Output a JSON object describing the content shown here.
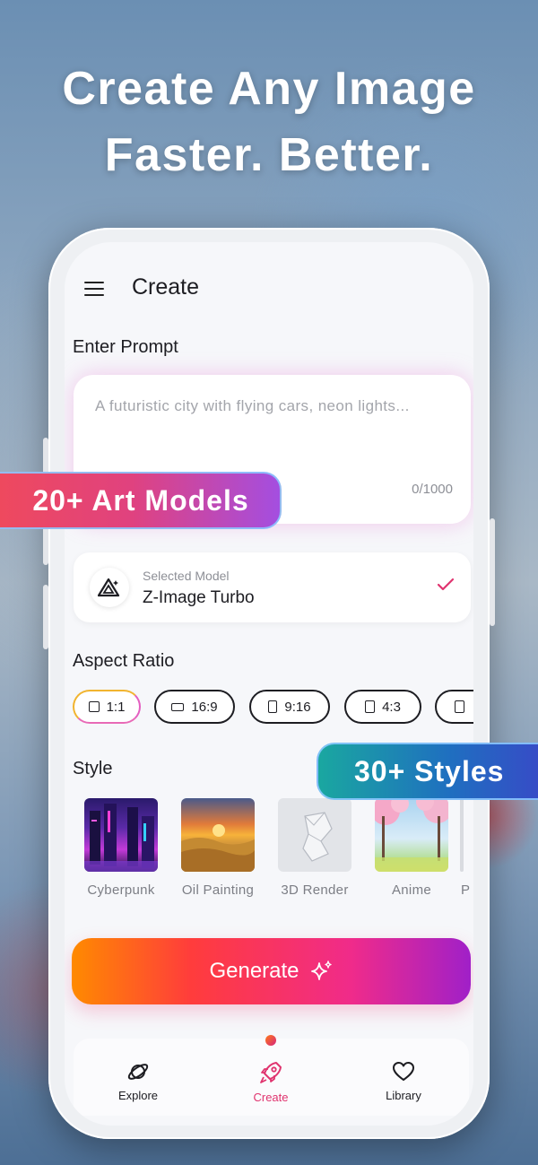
{
  "headline": {
    "line1": "Create Any Image",
    "line2": "Faster. Better."
  },
  "header": {
    "title": "Create"
  },
  "prompt": {
    "label": "Enter Prompt",
    "placeholder": "A futuristic city with flying cars, neon lights...",
    "char_count": "0/1000"
  },
  "model": {
    "caption": "Selected Model",
    "name": "Z-Image Turbo",
    "selected": true
  },
  "aspect_ratio": {
    "label": "Aspect Ratio",
    "options": [
      {
        "label": "1:1",
        "active": true
      },
      {
        "label": "16:9",
        "active": false
      },
      {
        "label": "9:16",
        "active": false
      },
      {
        "label": "4:3",
        "active": false
      },
      {
        "label": "",
        "active": false
      }
    ]
  },
  "style": {
    "label": "Style",
    "items": [
      {
        "label": "Cyberpunk"
      },
      {
        "label": "Oil Painting"
      },
      {
        "label": "3D Render"
      },
      {
        "label": "Anime"
      },
      {
        "label": "P"
      }
    ]
  },
  "generate": {
    "label": "Generate"
  },
  "nav": {
    "items": [
      {
        "label": "Explore",
        "icon": "planet-icon"
      },
      {
        "label": "Create",
        "icon": "rocket-icon",
        "active": true
      },
      {
        "label": "Library",
        "icon": "heart-icon"
      }
    ]
  },
  "badges": {
    "models": "20+ Art Models",
    "styles": "30+ Styles"
  },
  "colors": {
    "accent": "#e0346f",
    "gradient_start": "#ff8a00",
    "gradient_end": "#a020c8"
  }
}
